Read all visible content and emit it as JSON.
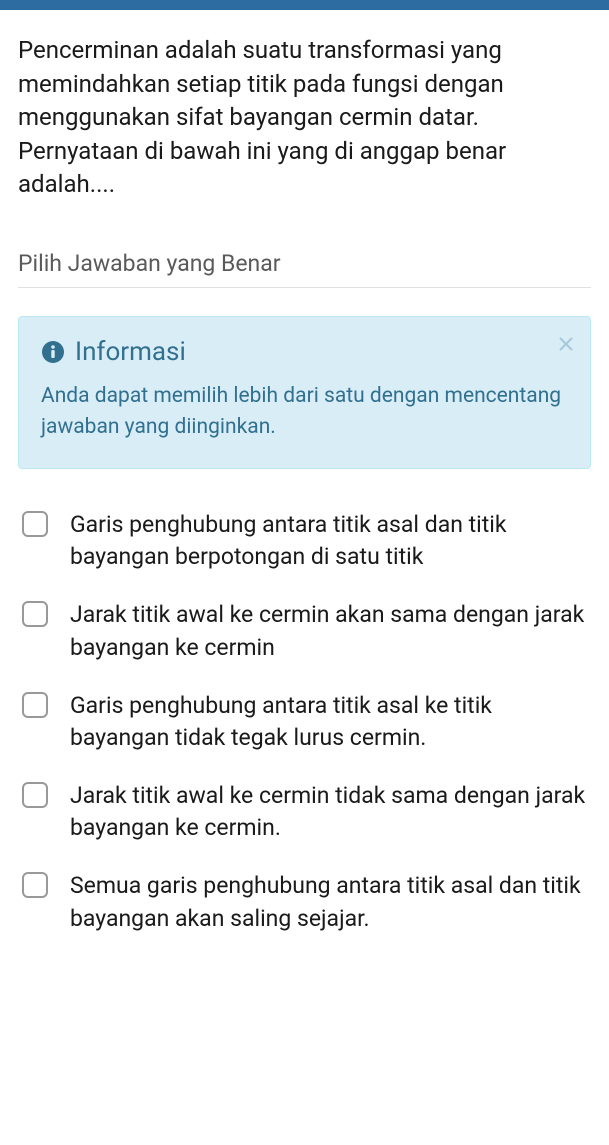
{
  "question": {
    "text": "Pencerminan adalah suatu transformasi yang memindahkan setiap titik pada fungsi dengan menggunakan sifat bayangan cermin datar. Pernyataan di bawah ini yang di anggap benar adalah...."
  },
  "section": {
    "heading": "Pilih Jawaban yang Benar"
  },
  "info": {
    "title": "Informasi",
    "body": "Anda dapat memilih lebih dari satu dengan mencentang jawaban yang diinginkan."
  },
  "options": [
    {
      "label": "Garis penghubung antara titik asal dan titik bayangan berpotongan di satu titik"
    },
    {
      "label": "Jarak titik awal ke cermin akan sama dengan jarak bayangan ke cermin"
    },
    {
      "label": "Garis penghubung antara titik asal ke titik bayangan tidak tegak lurus cermin."
    },
    {
      "label": "Jarak titik awal ke cermin tidak sama dengan jarak bayangan ke cermin."
    },
    {
      "label": "Semua garis penghubung antara titik asal  dan titik bayangan akan saling sejajar."
    }
  ]
}
